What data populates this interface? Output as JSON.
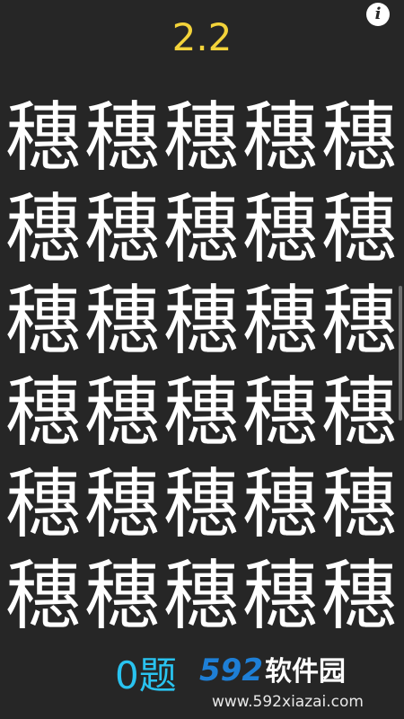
{
  "game": {
    "timer": "2.2",
    "info_icon": "info-icon",
    "grid": {
      "rows": 6,
      "cols": 5,
      "cells": [
        "穗",
        "穗",
        "穗",
        "穗",
        "穗",
        "穗",
        "穗",
        "穗",
        "穗",
        "穗",
        "穗",
        "穗",
        "穗",
        "穗",
        "穗",
        "穗",
        "穗",
        "穗",
        "穗",
        "穗",
        "穗",
        "穗",
        "穗",
        "穗",
        "穗",
        "穗",
        "穗",
        "穗",
        "穗",
        "穗"
      ]
    },
    "footer_text": "0题"
  },
  "watermark": {
    "number": "592",
    "name": "软件园",
    "url": "www.592xiazai.com"
  },
  "colors": {
    "background": "#262626",
    "timer": "#f3d33a",
    "character": "#ffffff",
    "footer": "#29c3f0",
    "watermark_number": "#1e7fd6"
  }
}
